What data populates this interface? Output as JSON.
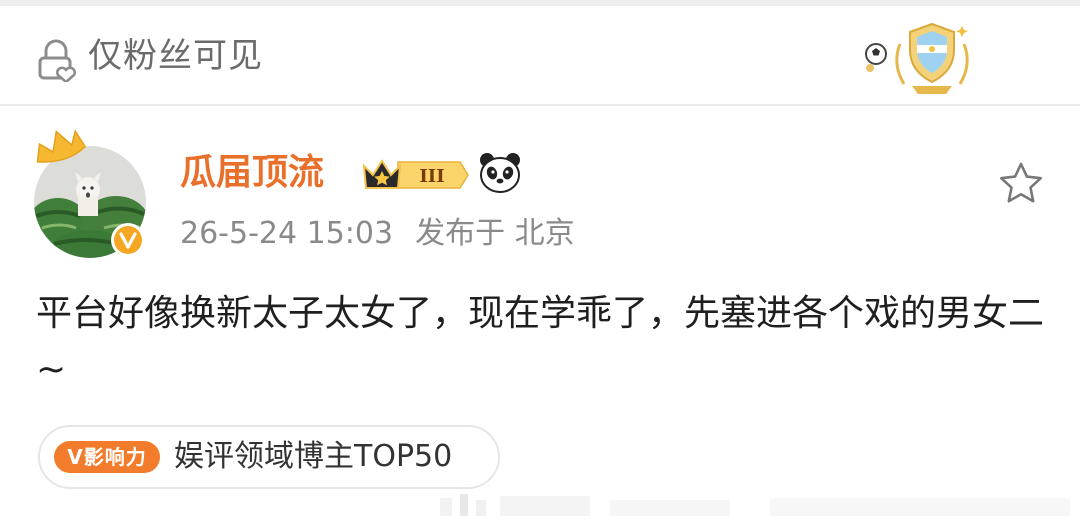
{
  "visibility": {
    "label": "仅粉丝可见"
  },
  "post": {
    "author": "瓜届顶流",
    "level": "III",
    "timestamp": "26-5-24 15:03",
    "location_prefix": "发布于",
    "location": "北京",
    "body": "平台好像换新太子太女了，现在学乖了，先塞进各个戏的男女二 ~"
  },
  "influence": {
    "logo_label": "V影响力",
    "text": "娱评领域博主TOP50"
  },
  "colors": {
    "accent_orange": "#f27b2c",
    "author_name": "#e8702a",
    "vip_orange": "#f5a623",
    "muted_text": "#8a8a8a"
  },
  "icons": {
    "visibility": "lock-heart-icon",
    "fan_badge": "football-shield-badge-icon",
    "verified": "verified-v-icon",
    "crown": "crown-icon",
    "panda": "panda-icon",
    "favorite": "star-outline-icon"
  }
}
